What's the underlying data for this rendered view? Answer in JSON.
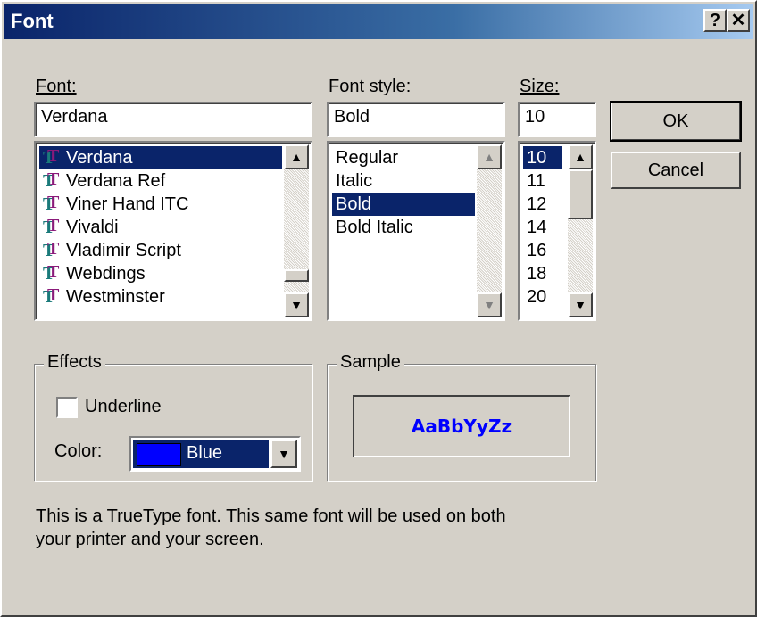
{
  "window": {
    "title": "Font",
    "help_label": "?",
    "close_label": "✕"
  },
  "font": {
    "label": "Font:",
    "value": "Verdana",
    "items": [
      "Verdana",
      "Verdana Ref",
      "Viner Hand ITC",
      "Vivaldi",
      "Vladimir Script",
      "Webdings",
      "Westminster"
    ],
    "selected_index": 0,
    "item_icon": "truetype-icon"
  },
  "style": {
    "label": "Font style:",
    "value": "Bold",
    "items": [
      "Regular",
      "Italic",
      "Bold",
      "Bold Italic"
    ],
    "selected_index": 2
  },
  "size": {
    "label": "Size:",
    "value": "10",
    "items": [
      "10",
      "11",
      "12",
      "14",
      "16",
      "18",
      "20"
    ],
    "selected_index": 0
  },
  "buttons": {
    "ok": "OK",
    "cancel": "Cancel"
  },
  "effects": {
    "title": "Effects",
    "underline_label": "Underline",
    "underline_checked": false,
    "color_label": "Color:",
    "color_value": "Blue",
    "color_hex": "#0000ff"
  },
  "sample": {
    "title": "Sample",
    "text": "AaBbYyZz",
    "text_color": "#0000ff"
  },
  "info": {
    "line1": "This is a TrueType font. This same font will be used on both",
    "line2": "your printer and your screen."
  },
  "colors": {
    "title_bar": "#0a246a",
    "selection": "#0a246a",
    "face": "#d4d0c8"
  }
}
